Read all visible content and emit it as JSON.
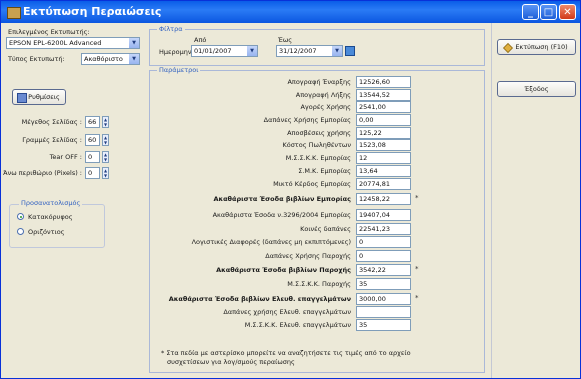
{
  "window": {
    "title": "Εκτύπωση Περαιώσεις",
    "minimize": "_",
    "maximize": "□",
    "close": "✕"
  },
  "left": {
    "printer_label": "Επιλεγμένος Εκτυπωτής:",
    "printer_value": "EPSON EPL-6200L Advanced",
    "printer_type_label": "Τύπος Εκτυπωτή:",
    "printer_type_value": "Ακαθόριστο",
    "settings_button": "Ρυθμίσεις",
    "spins": [
      {
        "label": "Μέγεθος Σελίδας :",
        "value": "66"
      },
      {
        "label": "Γραμμές Σελίδας :",
        "value": "60"
      },
      {
        "label": "Tear OFF :",
        "value": "0"
      },
      {
        "label": "Άνω περιθώριο (Pixels) :",
        "value": "0"
      }
    ],
    "orientation_label": "Προσανατολισμός",
    "orientation_options": [
      "Κατακόρυφος",
      "Οριζόντιος"
    ],
    "orientation_selected": "Κατακόρυφος"
  },
  "filters": {
    "legend": "Φίλτρα",
    "date_label": "Ημερομηνία :",
    "from_label": "Από",
    "to_label": "Έως",
    "from_value": "01/01/2007",
    "to_value": "31/12/2007"
  },
  "params": {
    "legend": "Παράμετροι",
    "rows": [
      {
        "label": "Απογραφή Έναρξης",
        "value": "12526,60",
        "bold": false,
        "star": false
      },
      {
        "label": "Απογραφή Λήξης",
        "value": "13544,52",
        "bold": false,
        "star": false
      },
      {
        "label": "Αγορές Χρήσης",
        "value": "2541,00",
        "bold": false,
        "star": false
      },
      {
        "label": "Δαπάνες Χρήσης Εμπορίας",
        "value": "0,00",
        "bold": false,
        "star": false
      },
      {
        "label": "Αποσβέσεις χρήσης",
        "value": "125,22",
        "bold": false,
        "star": false
      },
      {
        "label": "Κόστος Πωληθέντων",
        "value": "1523,08",
        "bold": false,
        "star": false
      },
      {
        "label": "Μ.Σ.Σ.Κ.Κ. Εμπορίας",
        "value": "12",
        "bold": false,
        "star": false
      },
      {
        "label": "Σ.Μ.Κ. Εμπορίας",
        "value": "13,64",
        "bold": false,
        "star": false
      },
      {
        "label": "Μικτό Κέρδος Εμπορίας",
        "value": "20774,81",
        "bold": false,
        "star": false
      },
      {
        "label": "Ακαθάριστα Έσοδα βιβλίων Εμπορίας",
        "value": "12458,22",
        "bold": true,
        "star": true
      },
      {
        "label": "Ακαθάριστα Έσοδα ν.3296/2004 Εμπορίας",
        "value": "19407,04",
        "bold": false,
        "star": false
      },
      {
        "label": "Κοινές δαπάνες",
        "value": "22541,23",
        "bold": false,
        "star": false
      },
      {
        "label": "Λογιστικές Διαφορές (δαπάνες μη εκπιπτόμενες)",
        "value": "0",
        "bold": false,
        "star": false
      },
      {
        "label": "Δαπάνες Χρήσης Παροχής",
        "value": "0",
        "bold": false,
        "star": false
      },
      {
        "label": "Ακαθάριστα Έσοδα βιβλίων Παροχής",
        "value": "3542,22",
        "bold": true,
        "star": true
      },
      {
        "label": "Μ.Σ.Σ.Κ.Κ. Παροχής",
        "value": "35",
        "bold": false,
        "star": false
      },
      {
        "label": "Ακαθάριστα Έσοδα βιβλίων Ελευθ. επαγγελμάτων",
        "value": "3000,00",
        "bold": true,
        "star": true
      },
      {
        "label": "Δαπάνες χρήσης Ελευθ. επαγγελμάτων",
        "value": "",
        "bold": false,
        "star": false
      },
      {
        "label": "Μ.Σ.Σ.Κ.Κ. Ελευθ. επαγγελμάτων",
        "value": "35",
        "bold": false,
        "star": false
      }
    ],
    "star_mark": "*",
    "footnote_line1": "* Στα πεδία με αστερίσκο μπορείτε να αναζητήσετε τις τιμές από το αρχείο",
    "footnote_line2": "συσχετίσεων για λογ/σμούς περαίωσης"
  },
  "right": {
    "print_button": "Εκτύπωση (F10)",
    "exit_button": "Έξοδος"
  },
  "colors": {
    "title_bar": "#0a5de8",
    "dialog_bg": "#ece9d8",
    "accent_text": "#3060c0",
    "radio_selected": "#2a9a2a"
  }
}
